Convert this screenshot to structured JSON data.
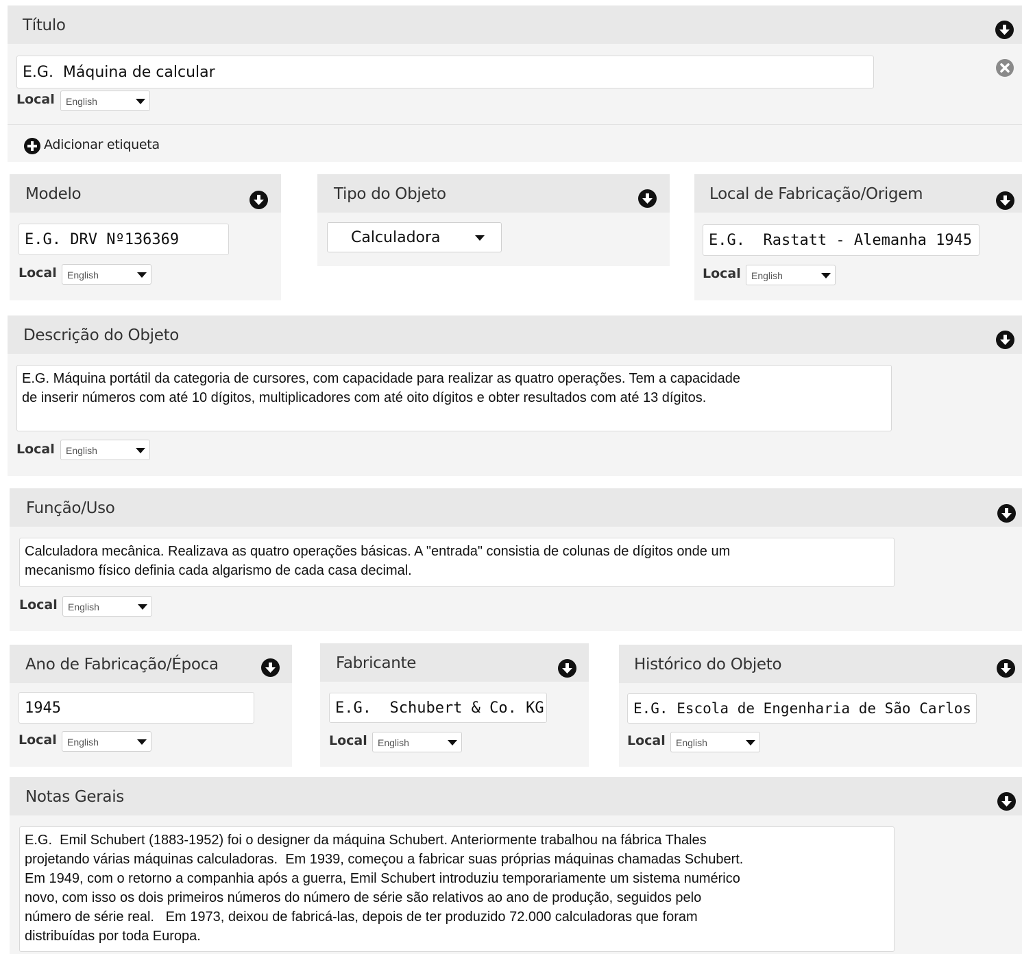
{
  "locale": {
    "label": "Local",
    "value": "English"
  },
  "titulo": {
    "title": "Título",
    "value": "E.G.  Máquina de calcular",
    "add_label": "Adicionar etiqueta"
  },
  "modelo": {
    "title": "Modelo",
    "value": "E.G. DRV Nº136369"
  },
  "tipo": {
    "title": "Tipo do Objeto",
    "value": "Calculadora"
  },
  "origem": {
    "title": "Local de Fabricação/Origem",
    "value": "E.G.  Rastatt - Alemanha 1945"
  },
  "descricao": {
    "title": "Descrição do Objeto",
    "value": "E.G. Máquina portátil da categoria de cursores, com capacidade para realizar as quatro operações. Tem a capacidade\nde inserir números com até 10 dígitos, multiplicadores com até oito dígitos e obter resultados com até 13 dígitos."
  },
  "funcao": {
    "title": "Função/Uso",
    "value": "Calculadora mecânica. Realizava as quatro operações básicas. A \"entrada\" consistia de colunas de dígitos onde um\nmecanismo físico definia cada algarismo de cada casa decimal."
  },
  "ano": {
    "title": "Ano de Fabricação/Época",
    "value": "1945"
  },
  "fabricante": {
    "title": "Fabricante",
    "value": "E.G.  Schubert & Co. KG"
  },
  "historico": {
    "title": "Histórico do Objeto",
    "value": "E.G. Escola de Engenharia de São Carlos"
  },
  "notas": {
    "title": "Notas Gerais",
    "value": "E.G.  Emil Schubert (1883-1952) foi o designer da máquina Schubert. Anteriormente trabalhou na fábrica Thales\nprojetando várias máquinas calculadoras.  Em 1939, começou a fabricar suas próprias máquinas chamadas Schubert.\nEm 1949, com o retorno a companhia após a guerra, Emil Schubert introduziu temporariamente um sistema numérico\nnovo, com isso os dois primeiros números do número de série são relativos ao ano de produção, seguidos pelo\nnúmero de série real.   Em 1973, deixou de fabricá-las, depois de ter produzido 72.000 calculadoras que foram\ndistribuídas por toda Europa."
  },
  "icons": {
    "toggle": "arrow-down-circle-icon",
    "remove": "close-circle-icon",
    "add": "plus-circle-icon"
  }
}
